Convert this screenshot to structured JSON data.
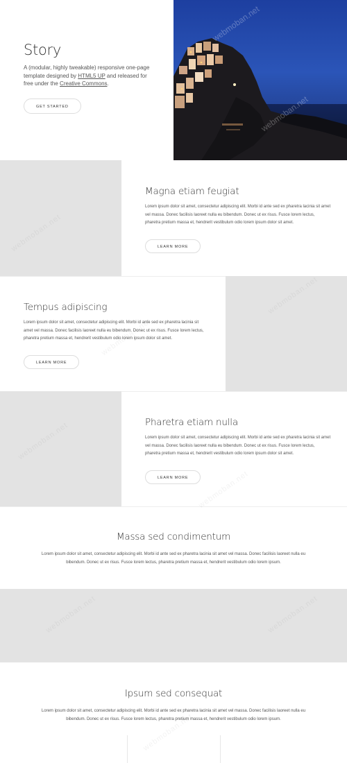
{
  "banner": {
    "title": "Story",
    "text_before": "A (modular, highly tweakable) responsive one-page template designed by ",
    "link1": "HTML5 UP",
    "text_middle": " and released for free under the ",
    "link2": "Creative Commons",
    "text_after": ".",
    "button": "GET STARTED",
    "watermark_text": "webmoban.net"
  },
  "spotlights": [
    {
      "title": "Magna etiam feugiat",
      "text": "Lorem ipsum dolor sit amet, consectetur adipiscing elit. Morbi id ante sed ex pharetra lacinia sit amet vel massa. Donec facilisis laoreet nulla eu bibendum. Donec ut ex risus. Fusce lorem lectus, pharetra pretium massa et, hendrerit vestibulum odio lorem ipsum dolor sit amet.",
      "button": "LEARN MORE"
    },
    {
      "title": "Tempus adipiscing",
      "text": "Lorem ipsum dolor sit amet, consectetur adipiscing elit. Morbi id ante sed ex pharetra lacinia sit amet vel massa. Donec facilisis laoreet nulla eu bibendum. Donec ut ex risus. Fusce lorem lectus, pharetra pretium massa et, hendrerit vestibulum odio lorem ipsum dolor sit amet.",
      "button": "LEARN MORE"
    },
    {
      "title": "Pharetra etiam nulla",
      "text": "Lorem ipsum dolor sit amet, consectetur adipiscing elit. Morbi id ante sed ex pharetra lacinia sit amet vel massa. Donec facilisis laoreet nulla eu bibendum. Donec ut ex risus. Fusce lorem lectus, pharetra pretium massa et, hendrerit vestibulum odio lorem ipsum dolor sit amet.",
      "button": "LEARN MORE"
    }
  ],
  "section1": {
    "title": "Massa sed condimentum",
    "text": "Lorem ipsum dolor sit amet, consectetur adipiscing elit. Morbi id ante sed ex pharetra lacinia sit amet vel massa. Donec facilisis laoreet nulla eu bibendum. Donec ut ex risus. Fusce lorem lectus, pharetra pretium massa et, hendrerit vestibulum odio lorem ipsum."
  },
  "section2": {
    "title": "Ipsum sed consequat",
    "text": "Lorem ipsum dolor sit amet, consectetur adipiscing elit. Morbi id ante sed ex pharetra lacinia sit amet vel massa. Donec facilisis laoreet nulla eu bibendum. Donec ut ex risus. Fusce lorem lectus, pharetra pretium massa et, hendrerit vestibulum odio lorem ipsum."
  }
}
